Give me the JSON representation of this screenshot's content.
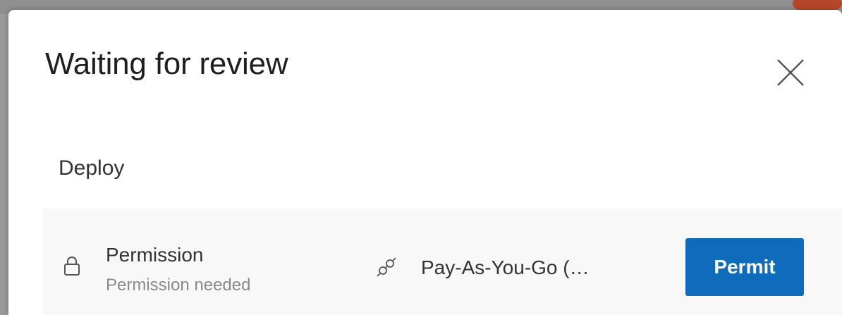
{
  "dialog": {
    "title": "Waiting for review",
    "close_icon": "close-icon"
  },
  "stage": {
    "label": "Deploy"
  },
  "check": {
    "icon": "lock-icon",
    "title": "Permission",
    "subtitle": "Permission needed",
    "resource_icon": "link-icon",
    "resource_name": "Pay-As-You-Go (…",
    "action_label": "Permit"
  },
  "colors": {
    "primary": "#0f6cbd",
    "row_background": "#f8f8f8"
  }
}
